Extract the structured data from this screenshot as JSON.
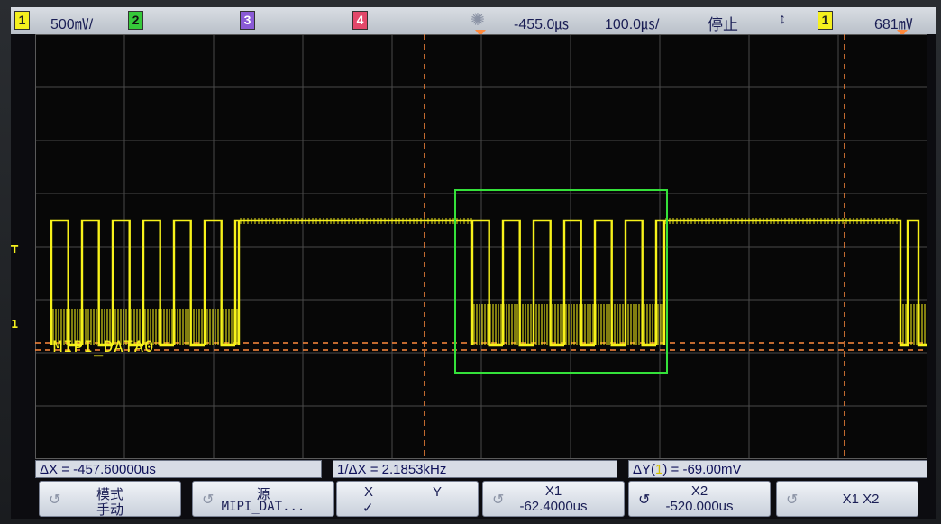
{
  "topbar": {
    "ch1_num": "1",
    "ch1_scale": "500㎷/",
    "ch2_num": "2",
    "ch3_num": "3",
    "ch4_num": "4",
    "trigger_icon": "trigger-sun-icon",
    "delay": "-455.0㎲",
    "timebase": "100.0㎲/",
    "run_state": "停止",
    "trig_mode_icon": "updown-arrow-icon",
    "trig_src": "1",
    "trig_level": "681㎷"
  },
  "trace": {
    "label": "MIPI_DATA0",
    "ground_marker": "1",
    "trigger_marker": "T",
    "color": "#f7f21a"
  },
  "readouts": {
    "dx": "ΔX = -457.60000us",
    "inv_dx": "1/ΔX = 2.1853kHz",
    "dy_prefix": "ΔY(",
    "dy_ch": "1",
    "dy_suffix": ") = -69.00mV"
  },
  "softkeys": {
    "mode_line1": "模式",
    "mode_line2": "手动",
    "source_line1": "源",
    "source_line2": "MIPI_DAT...",
    "xy_x": "X",
    "xy_y": "Y",
    "xy_check": "✓",
    "x1_label": "X1",
    "x1_value": "-62.4000us",
    "x2_label": "X2",
    "x2_value": "-520.000us",
    "x1x2_label": "X1 X2"
  },
  "colors": {
    "ch1": "#f5f01e",
    "ch2": "#36c93a",
    "ch3": "#8a5ad6",
    "ch4": "#e2486a",
    "cursor": "#ff8a3d",
    "highlight_box": "#34e13a"
  }
}
